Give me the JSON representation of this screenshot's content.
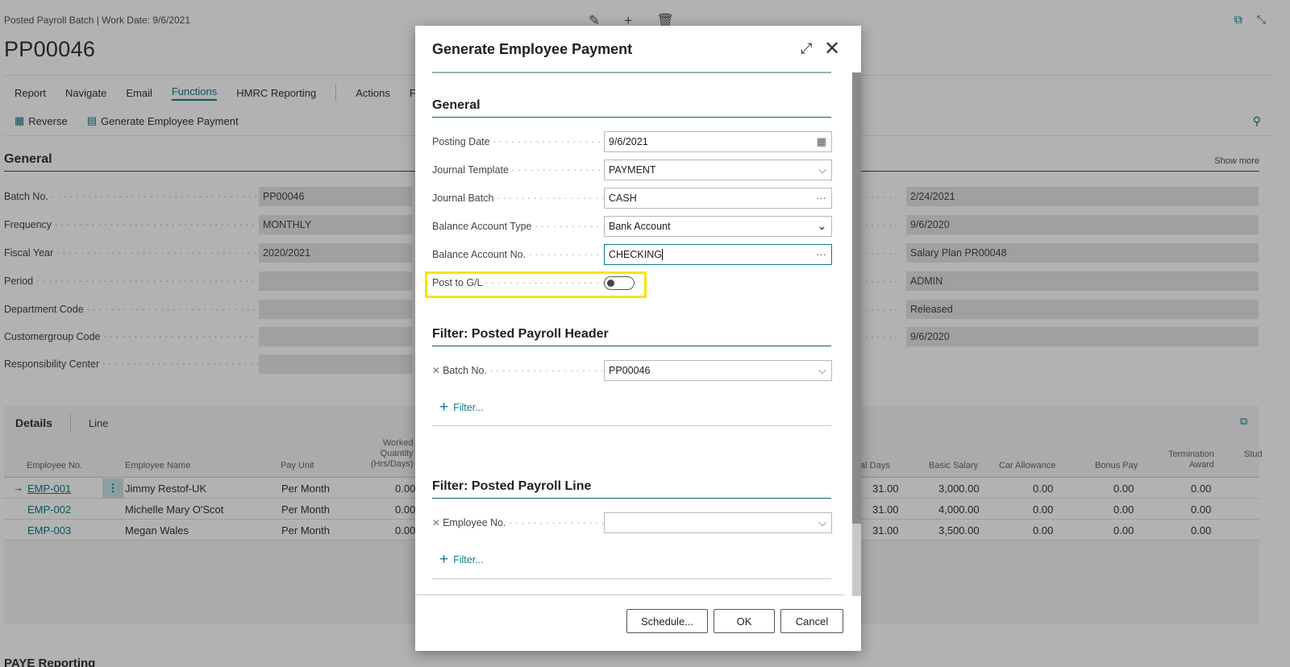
{
  "page": {
    "breadcrumb": "Posted Payroll Batch | Work Date: 9/6/2021",
    "record_no": "PP00046",
    "menu": [
      "Report",
      "Navigate",
      "Email",
      "Functions",
      "HMRC Reporting",
      "Actions",
      "Fe"
    ],
    "actions": [
      "Reverse",
      "Generate Employee Payment"
    ],
    "general_title": "General",
    "show_more": "Show more",
    "left_fields": [
      {
        "label": "Batch No.",
        "value": "PP00046"
      },
      {
        "label": "Frequency",
        "value": "MONTHLY"
      },
      {
        "label": "Fiscal Year",
        "value": "2020/2021"
      },
      {
        "label": "Period",
        "value": ""
      },
      {
        "label": "Department Code",
        "value": ""
      },
      {
        "label": "Customergroup Code",
        "value": ""
      },
      {
        "label": "Responsibility Center",
        "value": ""
      }
    ],
    "right_values": [
      "2/24/2021",
      "9/6/2020",
      "Salary Plan PR00048",
      "ADMIN",
      "Released",
      "9/6/2020"
    ],
    "details_tab": "Details",
    "line_tab": "Line",
    "columns": {
      "employee_no": "Employee No.",
      "employee_name": "Employee Name",
      "pay_unit": "Pay Unit",
      "worked_qty_1": "Worked",
      "worked_qty_2": "Quantity",
      "worked_qty_3": "(Hrs/Days)",
      "total_days": "tal Days",
      "basic_salary": "Basic Salary",
      "car_allowance": "Car Allowance",
      "bonus_pay": "Bonus Pay",
      "termination_1": "Termination",
      "termination_2": "Award",
      "stud": "Stud"
    },
    "rows": [
      {
        "emp_no": "EMP-001",
        "name": "Jimmy Restof-UK",
        "pay_unit": "Per Month",
        "worked": "0.00",
        "days": "31.00",
        "salary": "3,000.00",
        "car": "0.00",
        "bonus": "0.00",
        "term": "0.00"
      },
      {
        "emp_no": "EMP-002",
        "name": "Michelle Mary O'Scot",
        "pay_unit": "Per Month",
        "worked": "0.00",
        "days": "31.00",
        "salary": "4,000.00",
        "car": "0.00",
        "bonus": "0.00",
        "term": "0.00"
      },
      {
        "emp_no": "EMP-003",
        "name": "Megan Wales",
        "pay_unit": "Per Month",
        "worked": "0.00",
        "days": "31.00",
        "salary": "3,500.00",
        "car": "0.00",
        "bonus": "0.00",
        "term": "0.00"
      }
    ],
    "paye_title": "PAYE Reporting"
  },
  "dialog": {
    "title": "Generate Employee Payment",
    "general_section": "General",
    "posting_date": {
      "label": "Posting Date",
      "value": "9/6/2021"
    },
    "journal_template": {
      "label": "Journal Template",
      "value": "PAYMENT"
    },
    "journal_batch": {
      "label": "Journal Batch",
      "value": "CASH"
    },
    "balance_account_type": {
      "label": "Balance Account Type",
      "value": "Bank Account"
    },
    "balance_account_no": {
      "label": "Balance Account No.",
      "value": "CHECKING"
    },
    "post_to_gl": {
      "label": "Post to G/L",
      "value": false
    },
    "filter_header_section": "Filter: Posted Payroll Header",
    "filter_header_field": {
      "label": "Batch No.",
      "value": "PP00046"
    },
    "filter_line_section": "Filter: Posted Payroll Line",
    "filter_line_field": {
      "label": "Employee No.",
      "value": ""
    },
    "add_filter": "Filter...",
    "buttons": {
      "schedule": "Schedule...",
      "ok": "OK",
      "cancel": "Cancel"
    }
  },
  "colors": {
    "accent": "#0e7a86",
    "highlight": "#f5e400"
  }
}
